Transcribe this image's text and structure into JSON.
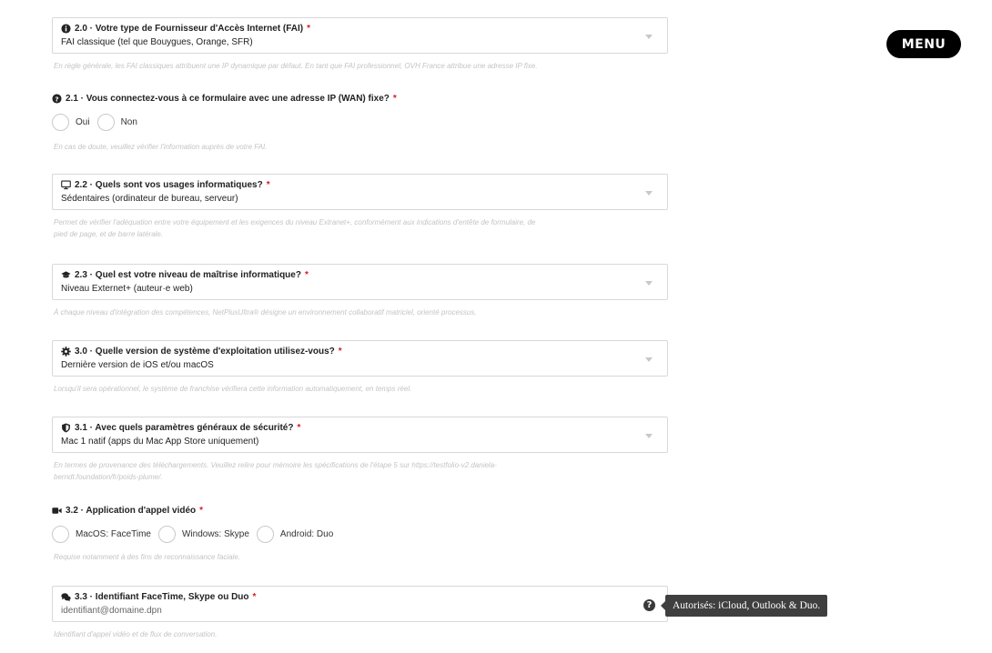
{
  "menu": {
    "label": "MENU"
  },
  "required_mark": "*",
  "q20": {
    "label": "2.0 · Votre type de Fournisseur d'Accès Internet (FAI)",
    "value": "FAI classique (tel que Bouygues, Orange, SFR)",
    "help": "En règle générale, les FAI classiques attribuent une IP dynamique par défaut. En tant que FAI professionnel, OVH France attribue une adresse IP fixe."
  },
  "q21": {
    "label": "2.1 · Vous connectez-vous à ce formulaire avec une adresse IP (WAN) fixe?",
    "options": [
      "Oui",
      "Non"
    ],
    "help": "En cas de doute, veuillez vérifier l'information auprès de votre FAI."
  },
  "q22": {
    "label": "2.2 · Quels sont vos usages informatiques?",
    "value": "Sédentaires (ordinateur de bureau, serveur)",
    "help_line1": "Permet de vérifier l'adéquation entre votre équipement et les exigences du niveau Extranet+, conformément aux indications d'entête de formulaire, de",
    "help_line2": "pied de page, et de barre latérale."
  },
  "q23": {
    "label": "2.3 · Quel est votre niveau de maîtrise informatique?",
    "value": "Niveau Externet+ (auteur·e web)",
    "help": "À chaque niveau d'intégration des compétences, NetPlusUltra® désigne un environnement collaboratif matriciel, orienté processus."
  },
  "q30": {
    "label": "3.0 · Quelle version de système d'exploitation utilisez-vous?",
    "value": "Dernière version de iOS et/ou macOS",
    "help": "Lorsqu'il sera opérationnel, le système de franchise vérifiera cette information automatiquement, en temps réel."
  },
  "q31": {
    "label": "3.1 · Avec quels paramètres généraux de sécurité?",
    "value": "Mac 1 natif (apps du Mac App Store uniquement)",
    "help_line1": "En termes de provenance des téléchargements. Veuillez relire pour mémoire les spécifications de l'étape 5 sur https://testfolio-v2.daniela-",
    "help_line2": "berndt.foundation/fr/poids-plume/."
  },
  "q32": {
    "label": "3.2 · Application d'appel vidéo",
    "options": [
      "MacOS: FaceTime",
      "Windows: Skype",
      "Android: Duo"
    ],
    "help": "Requise notamment à des fins de reconnaissance faciale."
  },
  "q33": {
    "label": "3.3 · Identifiant FaceTime, Skype ou Duo",
    "placeholder": "identifiant@domaine.dpn",
    "help": "Identifiant d'appel vidéo et de flux de conversation.",
    "help_icon": "?",
    "tooltip": "Autorisés: iCloud, Outlook & Duo."
  },
  "icons": {
    "q20": "info-circle-icon",
    "q21": "question-circle-icon",
    "q22": "desktop-icon",
    "q23": "graduation-cap-icon",
    "q30": "cog-icon",
    "q31": "shield-icon",
    "q32": "video-camera-icon",
    "q33": "comments-icon"
  },
  "colors": {
    "required": "#d21f1f",
    "help_text": "#c4c4c4",
    "tooltip_bg": "#3f3f3f"
  }
}
